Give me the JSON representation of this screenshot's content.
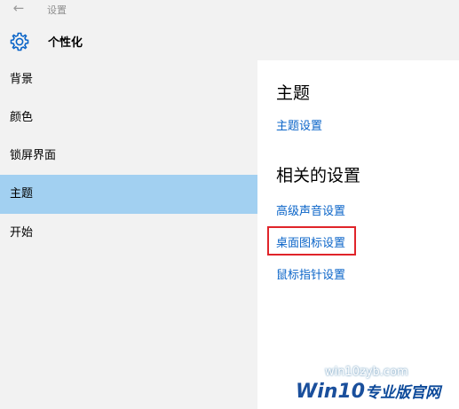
{
  "header": {
    "breadcrumb": "设置",
    "title": "个性化"
  },
  "sidebar": {
    "items": [
      {
        "label": "背景"
      },
      {
        "label": "颜色"
      },
      {
        "label": "锁屏界面"
      },
      {
        "label": "主题"
      },
      {
        "label": "开始"
      }
    ],
    "active_index": 3
  },
  "main": {
    "section1_title": "主题",
    "theme_settings_link": "主题设置",
    "section2_title": "相关的设置",
    "related_links": [
      {
        "label": "高级声音设置"
      },
      {
        "label": "桌面图标设置"
      },
      {
        "label": "鼠标指针设置"
      }
    ]
  },
  "watermark": {
    "url": "win10zyb.com",
    "logo_prefix": "Win10",
    "logo_suffix": "专业版官网"
  },
  "colors": {
    "accent_link": "#0a64c8",
    "active_nav": "#a2d0f1",
    "highlight_border": "#e0242a",
    "panel_bg": "#f2f2f2"
  },
  "icons": {
    "back": "back-arrow-icon",
    "settings": "gear-icon"
  }
}
